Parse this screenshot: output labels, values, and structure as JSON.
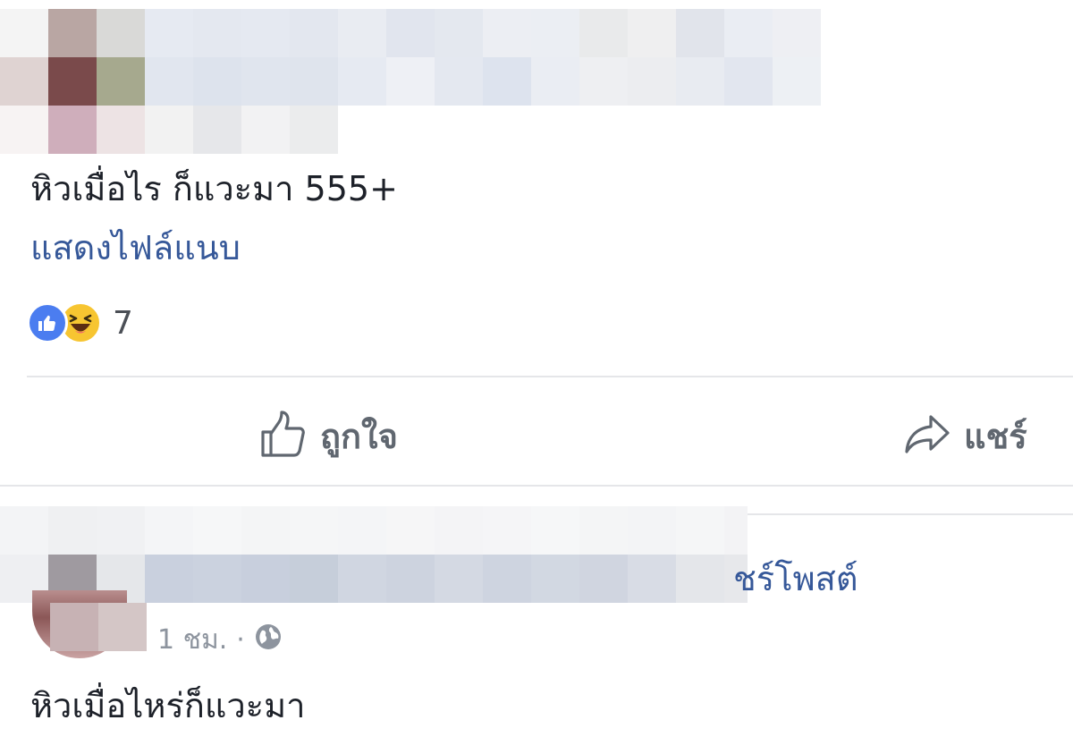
{
  "post": {
    "text": "หิวเมื่อไร ก็แวะมา 555+",
    "attachment_link": "แสดงไฟล์แนบ",
    "reactions": {
      "types": [
        "like-icon",
        "haha-icon"
      ],
      "count": "7"
    }
  },
  "actions": {
    "like_label": "ถูกใจ",
    "share_label": "แชร์"
  },
  "second_post": {
    "shared_label": "ชร์โพสต์",
    "time": "1 ชม.",
    "separator": "·",
    "text": "หิวเมื่อไหร่ก็แวะมา"
  },
  "colors": {
    "link": "#365899",
    "like_blue": "#4b7df0",
    "haha_yellow": "#f7c531",
    "action_gray": "#606770",
    "divider": "#e5e6e9"
  }
}
